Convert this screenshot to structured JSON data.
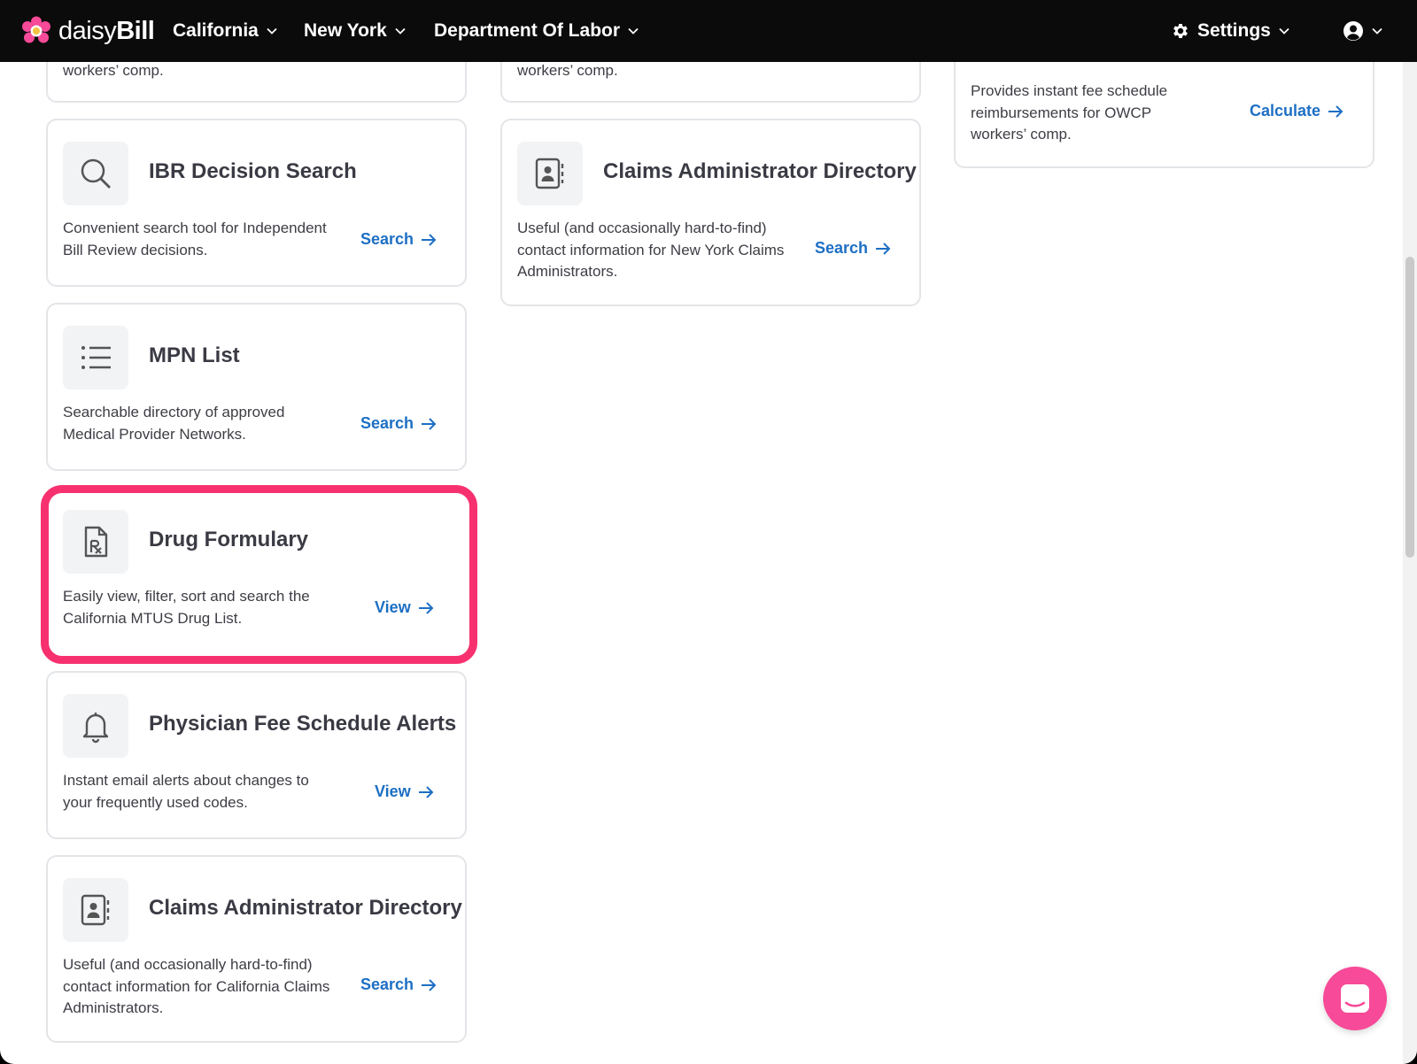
{
  "nav": {
    "logo_text_light": "daisy",
    "logo_text_bold": "Bill",
    "items": [
      "California",
      "New York",
      "Department Of Labor"
    ],
    "settings_label": "Settings"
  },
  "top_cards": [
    {
      "desc": "workers’ comp."
    },
    {
      "desc": "workers’ comp."
    },
    {
      "desc": "Provides instant fee schedule reimbursements for OWCP workers’ comp.",
      "link": "Calculate"
    }
  ],
  "cards_col1": [
    {
      "title": "IBR Decision Search",
      "icon": "search-icon",
      "desc": "Convenient search tool for Independent Bill Review decisions.",
      "link": "Search"
    },
    {
      "title": "MPN List",
      "icon": "list-icon",
      "desc": "Searchable directory of approved Medical Provider Networks.",
      "link": "Search"
    },
    {
      "title": "Drug Formulary",
      "icon": "prescription-icon",
      "desc": "Easily view, filter, sort and search the California MTUS Drug List.",
      "link": "View"
    },
    {
      "title": "Physician Fee Schedule Alerts",
      "icon": "bell-icon",
      "desc": "Instant email alerts about changes to your frequently used codes.",
      "link": "View"
    },
    {
      "title": "Claims Administrator Directory",
      "icon": "contact-book-icon",
      "desc": "Useful (and occasionally hard-to-find) contact information for California Claims Administrators.",
      "link": "Search"
    }
  ],
  "cards_col2": [
    {
      "title": "Claims Administrator Directory",
      "icon": "contact-book-icon",
      "desc": "Useful (and occasionally hard-to-find) contact information for New York Claims Administrators.",
      "link": "Search"
    }
  ],
  "colors": {
    "nav_bg": "#0b0b0b",
    "link": "#1d6fc4",
    "highlight": "#f7316f",
    "chat_button": "#f74a98",
    "card_border": "#e3e5e8"
  }
}
